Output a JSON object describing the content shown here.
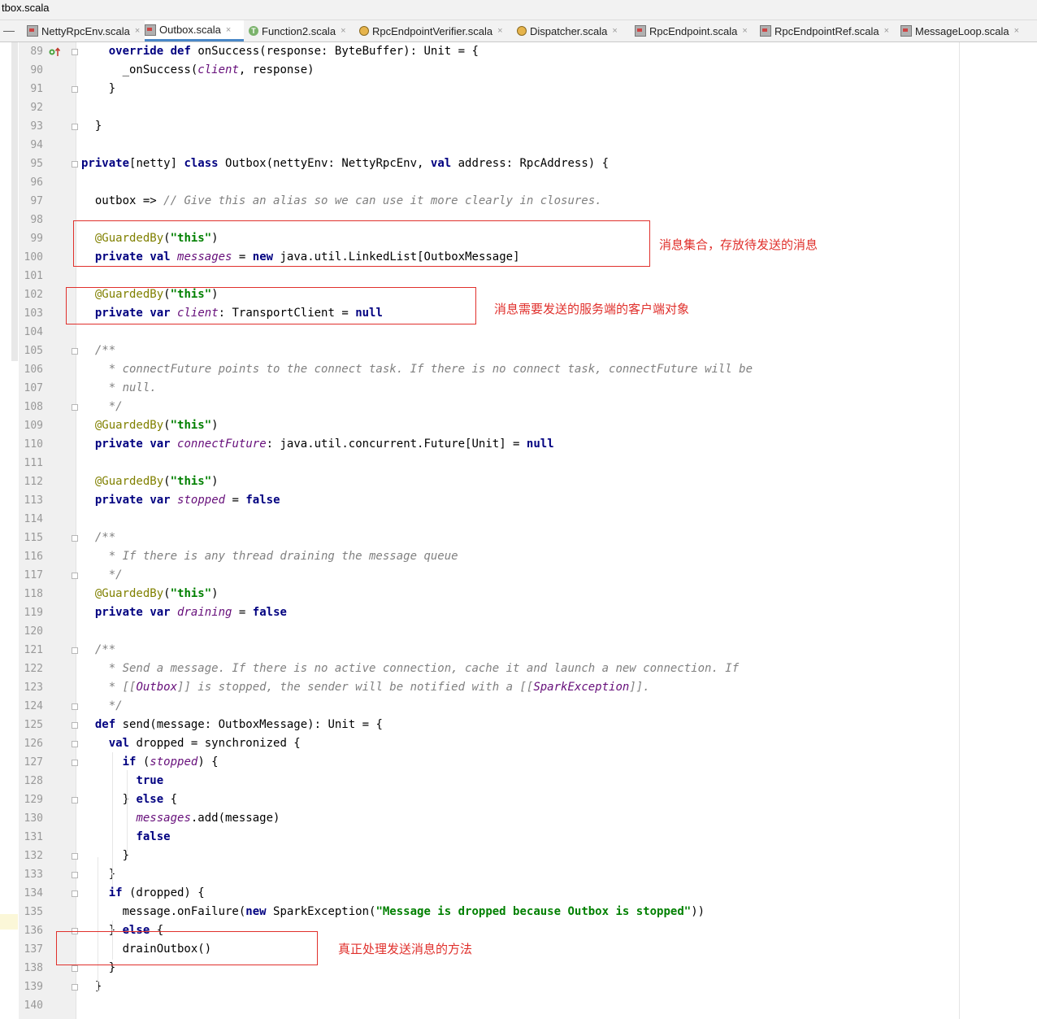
{
  "window": {
    "title": "tbox.scala"
  },
  "tabs": [
    {
      "label": "NettyRpcEnv.scala",
      "icon": "scala-file-icon",
      "active": false
    },
    {
      "label": "Outbox.scala",
      "icon": "scala-file-icon",
      "active": true
    },
    {
      "label": "Function2.scala",
      "icon": "trait-icon",
      "active": false
    },
    {
      "label": "RpcEndpointVerifier.scala",
      "icon": "object-icon",
      "active": false
    },
    {
      "label": "Dispatcher.scala",
      "icon": "object-icon",
      "active": false
    },
    {
      "label": "RpcEndpoint.scala",
      "icon": "scala-file-icon",
      "active": false
    },
    {
      "label": "RpcEndpointRef.scala",
      "icon": "scala-file-icon",
      "active": false
    },
    {
      "label": "MessageLoop.scala",
      "icon": "scala-file-icon",
      "active": false
    }
  ],
  "code": {
    "first_line": 89,
    "lines": [
      [
        [
          "    ",
          ""
        ],
        [
          "override",
          "kw"
        ],
        [
          " ",
          ""
        ],
        [
          "def",
          "kw"
        ],
        [
          " onSuccess(response: ByteBuffer): Unit = {",
          ""
        ]
      ],
      [
        [
          "      _onSuccess(",
          ""
        ],
        [
          "client",
          "fld"
        ],
        [
          ", response)",
          ""
        ]
      ],
      [
        [
          "    }",
          ""
        ]
      ],
      [
        [
          "",
          ""
        ]
      ],
      [
        [
          "  }",
          ""
        ]
      ],
      [
        [
          "",
          ""
        ]
      ],
      [
        [
          "private",
          "kw"
        ],
        [
          "[netty] ",
          ""
        ],
        [
          "class",
          "kw"
        ],
        [
          " Outbox(nettyEnv: NettyRpcEnv, ",
          ""
        ],
        [
          "val",
          "kw"
        ],
        [
          " address: RpcAddress) {",
          ""
        ]
      ],
      [
        [
          "",
          ""
        ]
      ],
      [
        [
          "  outbox => ",
          ""
        ],
        [
          "// Give this an alias so we can use it more clearly in closures.",
          "cm"
        ]
      ],
      [
        [
          "",
          ""
        ]
      ],
      [
        [
          "  ",
          ""
        ],
        [
          "@GuardedBy",
          "ann"
        ],
        [
          "(",
          ""
        ],
        [
          "\"this\"",
          "str"
        ],
        [
          ")",
          ""
        ]
      ],
      [
        [
          "  ",
          ""
        ],
        [
          "private",
          "kw"
        ],
        [
          " ",
          ""
        ],
        [
          "val",
          "kw"
        ],
        [
          " ",
          ""
        ],
        [
          "messages",
          "fld"
        ],
        [
          " = ",
          ""
        ],
        [
          "new",
          "kw"
        ],
        [
          " java.util.LinkedList[OutboxMessage]",
          ""
        ]
      ],
      [
        [
          "",
          ""
        ]
      ],
      [
        [
          "  ",
          ""
        ],
        [
          "@GuardedBy",
          "ann"
        ],
        [
          "(",
          ""
        ],
        [
          "\"this\"",
          "str"
        ],
        [
          ")",
          ""
        ]
      ],
      [
        [
          "  ",
          ""
        ],
        [
          "private",
          "kw"
        ],
        [
          " ",
          ""
        ],
        [
          "var",
          "kw"
        ],
        [
          " ",
          ""
        ],
        [
          "client",
          "fld"
        ],
        [
          ": TransportClient = ",
          ""
        ],
        [
          "null",
          "kw"
        ]
      ],
      [
        [
          "",
          ""
        ]
      ],
      [
        [
          "  ",
          ""
        ],
        [
          "/**",
          "cm"
        ]
      ],
      [
        [
          "  ",
          ""
        ],
        [
          "  * connectFuture points to the connect task. If there is no connect task, connectFuture will be",
          "cm"
        ]
      ],
      [
        [
          "  ",
          ""
        ],
        [
          "  * null.",
          "cm"
        ]
      ],
      [
        [
          "  ",
          ""
        ],
        [
          "  */",
          "cm"
        ]
      ],
      [
        [
          "  ",
          ""
        ],
        [
          "@GuardedBy",
          "ann"
        ],
        [
          "(",
          ""
        ],
        [
          "\"this\"",
          "str"
        ],
        [
          ")",
          ""
        ]
      ],
      [
        [
          "  ",
          ""
        ],
        [
          "private",
          "kw"
        ],
        [
          " ",
          ""
        ],
        [
          "var",
          "kw"
        ],
        [
          " ",
          ""
        ],
        [
          "connectFuture",
          "fld"
        ],
        [
          ": java.util.concurrent.Future[Unit] = ",
          ""
        ],
        [
          "null",
          "kw"
        ]
      ],
      [
        [
          "",
          ""
        ]
      ],
      [
        [
          "  ",
          ""
        ],
        [
          "@GuardedBy",
          "ann"
        ],
        [
          "(",
          ""
        ],
        [
          "\"this\"",
          "str"
        ],
        [
          ")",
          ""
        ]
      ],
      [
        [
          "  ",
          ""
        ],
        [
          "private",
          "kw"
        ],
        [
          " ",
          ""
        ],
        [
          "var",
          "kw"
        ],
        [
          " ",
          ""
        ],
        [
          "stopped",
          "fld"
        ],
        [
          " = ",
          ""
        ],
        [
          "false",
          "kw"
        ]
      ],
      [
        [
          "",
          ""
        ]
      ],
      [
        [
          "  ",
          ""
        ],
        [
          "/**",
          "cm"
        ]
      ],
      [
        [
          "  ",
          ""
        ],
        [
          "  * If there is any thread draining the message queue",
          "cm"
        ]
      ],
      [
        [
          "  ",
          ""
        ],
        [
          "  */",
          "cm"
        ]
      ],
      [
        [
          "  ",
          ""
        ],
        [
          "@GuardedBy",
          "ann"
        ],
        [
          "(",
          ""
        ],
        [
          "\"this\"",
          "str"
        ],
        [
          ")",
          ""
        ]
      ],
      [
        [
          "  ",
          ""
        ],
        [
          "private",
          "kw"
        ],
        [
          " ",
          ""
        ],
        [
          "var",
          "kw"
        ],
        [
          " ",
          ""
        ],
        [
          "draining",
          "fld"
        ],
        [
          " = ",
          ""
        ],
        [
          "false",
          "kw"
        ]
      ],
      [
        [
          "",
          ""
        ]
      ],
      [
        [
          "  ",
          ""
        ],
        [
          "/**",
          "cm"
        ]
      ],
      [
        [
          "  ",
          ""
        ],
        [
          "  * Send a message. If there is no active connection, cache it and launch a new connection. If",
          "cm"
        ]
      ],
      [
        [
          "  ",
          ""
        ],
        [
          "  * [[",
          "cm"
        ],
        [
          "Outbox",
          "fld"
        ],
        [
          "]] is stopped, the sender will be notified with a [[",
          "cm"
        ],
        [
          "SparkException",
          "fld"
        ],
        [
          "]].",
          "cm"
        ]
      ],
      [
        [
          "  ",
          ""
        ],
        [
          "  */",
          "cm"
        ]
      ],
      [
        [
          "  ",
          ""
        ],
        [
          "def",
          "kw"
        ],
        [
          " send(message: OutboxMessage): Unit = {",
          ""
        ]
      ],
      [
        [
          "    ",
          ""
        ],
        [
          "val",
          "kw"
        ],
        [
          " dropped = synchronized {",
          ""
        ]
      ],
      [
        [
          "      ",
          ""
        ],
        [
          "if",
          "kw"
        ],
        [
          " (",
          ""
        ],
        [
          "stopped",
          "fld"
        ],
        [
          ") {",
          ""
        ]
      ],
      [
        [
          "        ",
          ""
        ],
        [
          "true",
          "kw"
        ]
      ],
      [
        [
          "      } ",
          ""
        ],
        [
          "else",
          "kw"
        ],
        [
          " {",
          ""
        ]
      ],
      [
        [
          "        ",
          ""
        ],
        [
          "messages",
          "fld"
        ],
        [
          ".add(message)",
          ""
        ]
      ],
      [
        [
          "        ",
          ""
        ],
        [
          "false",
          "kw"
        ]
      ],
      [
        [
          "      }",
          ""
        ]
      ],
      [
        [
          "    }",
          ""
        ]
      ],
      [
        [
          "    ",
          ""
        ],
        [
          "if",
          "kw"
        ],
        [
          " (dropped) {",
          ""
        ]
      ],
      [
        [
          "      message.onFailure(",
          ""
        ],
        [
          "new",
          "kw"
        ],
        [
          " SparkException(",
          ""
        ],
        [
          "\"Message is dropped because Outbox is stopped\"",
          "str"
        ],
        [
          "))",
          ""
        ]
      ],
      [
        [
          "    } ",
          ""
        ],
        [
          "else",
          "kw"
        ],
        [
          " {",
          ""
        ]
      ],
      [
        [
          "      drainOutbox()",
          ""
        ]
      ],
      [
        [
          "    }",
          ""
        ]
      ],
      [
        [
          "  }",
          ""
        ]
      ],
      [
        [
          "",
          ""
        ]
      ]
    ]
  },
  "annotations": [
    {
      "text": "消息集合，存放待发送的消息"
    },
    {
      "text": "消息需要发送的服务端的客户端对象"
    },
    {
      "text": "真正处理发送消息的方法"
    }
  ],
  "colors": {
    "keyword": "#000080",
    "string": "#008000",
    "annotation": "#808000",
    "comment": "#808080",
    "field": "#660e7a",
    "note": "#e0302c"
  }
}
